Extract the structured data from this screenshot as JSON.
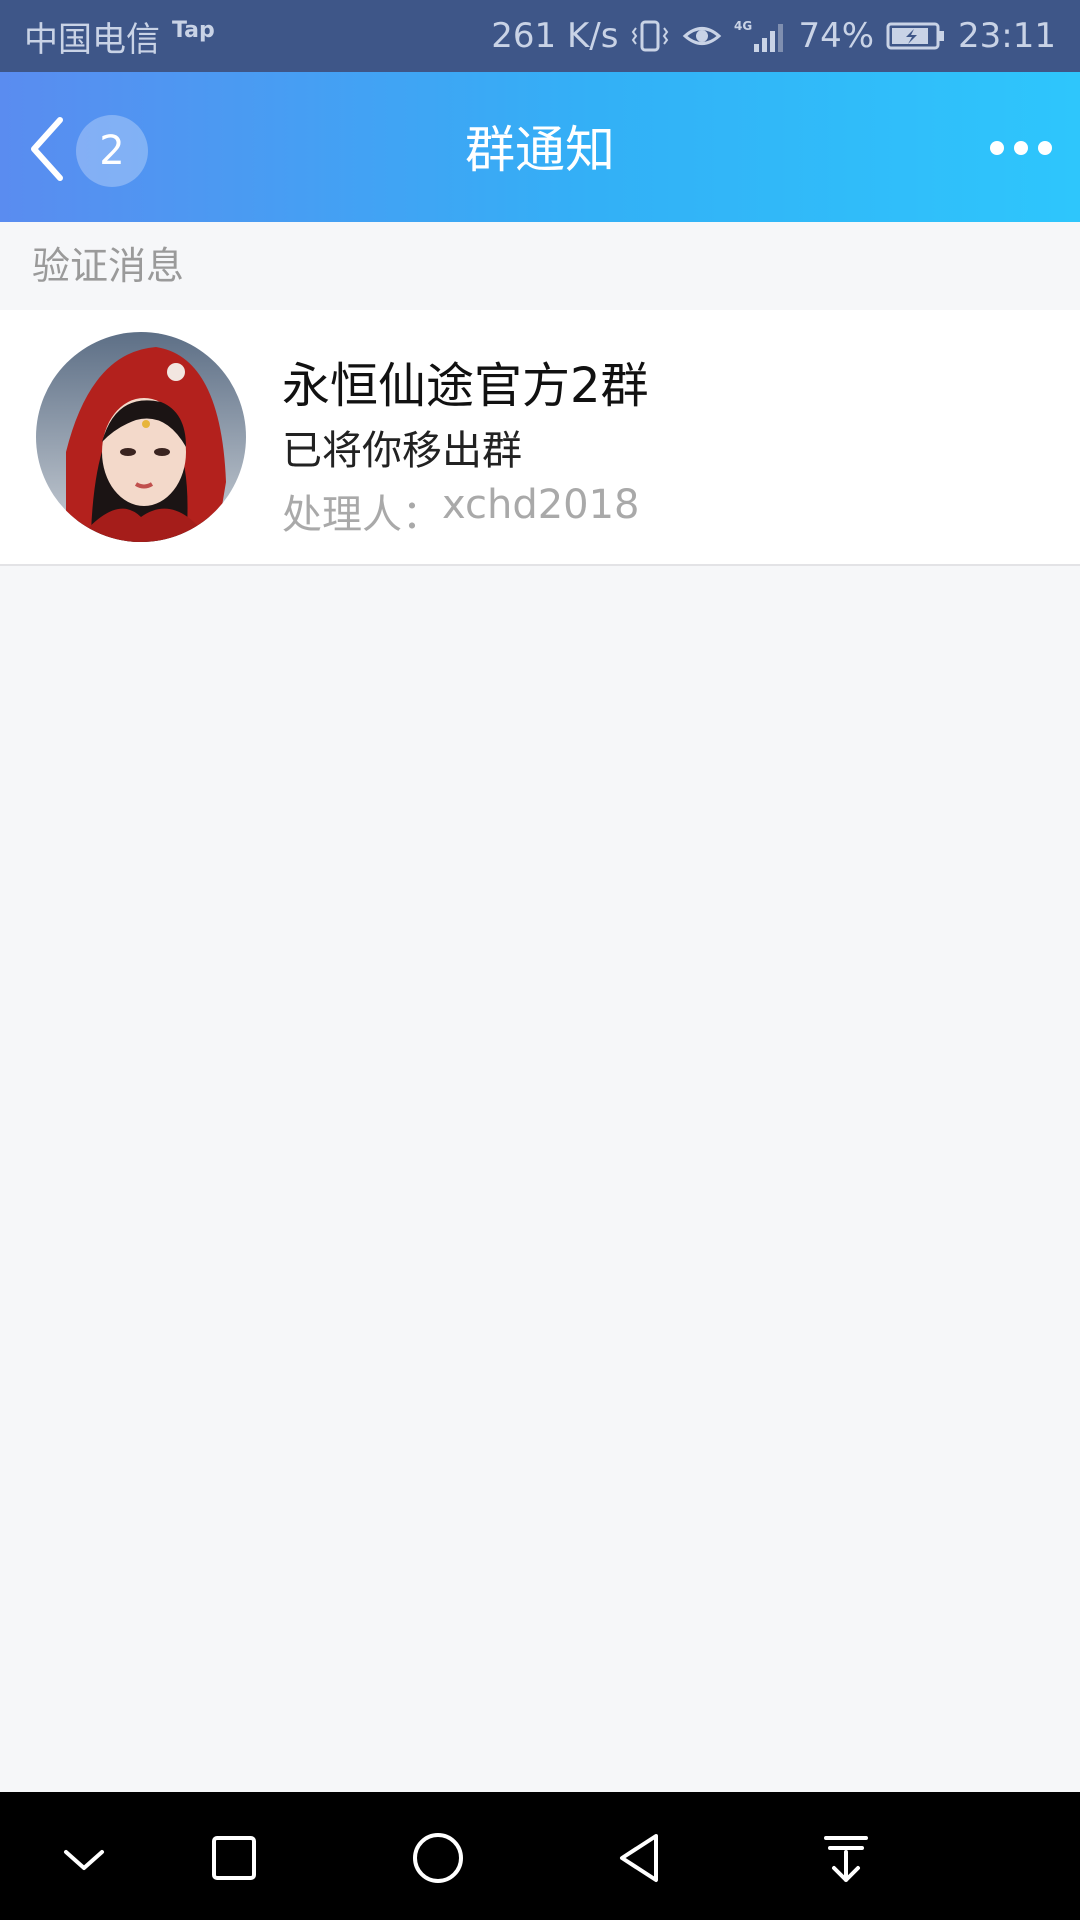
{
  "status_bar": {
    "carrier": "中国电信",
    "carrier_tag": "Tap",
    "net_speed": "261 K/s",
    "network_type": "4G",
    "battery": "74%",
    "time": "23:11"
  },
  "header": {
    "back_badge": "2",
    "title": "群通知",
    "icons": {
      "back": "chevron-left-icon",
      "more": "more-dots-icon"
    }
  },
  "section": {
    "title": "验证消息"
  },
  "notifications": [
    {
      "group_name": "永恒仙途官方2群",
      "action": "已将你移出群",
      "handler_label": "处理人：",
      "handler": "xchd2018"
    }
  ],
  "system_nav": {
    "buttons": [
      "chevron-down-icon",
      "square-icon",
      "circle-icon",
      "triangle-back-icon",
      "download-arrow-icon"
    ]
  },
  "colors": {
    "status_bar": "#3e5688",
    "header_gradient_start": "#5a8cf0",
    "header_gradient_end": "#2ec6fc",
    "background": "#f6f7f9"
  }
}
